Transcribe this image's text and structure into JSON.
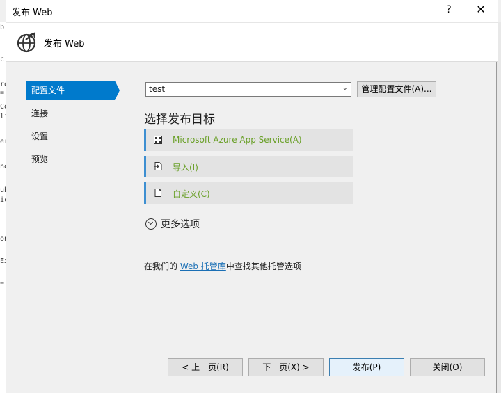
{
  "window": {
    "title": "发布 Web",
    "help_glyph": "?",
    "close_glyph": "✕"
  },
  "header": {
    "title": "发布 Web",
    "icon": "globe-publish-icon"
  },
  "nav": {
    "items": [
      {
        "label": "配置文件",
        "active": true
      },
      {
        "label": "连接",
        "active": false
      },
      {
        "label": "设置",
        "active": false
      },
      {
        "label": "预览",
        "active": false
      }
    ]
  },
  "profile": {
    "selected": "test",
    "manage_label": "管理配置文件(A)..."
  },
  "publish_target": {
    "title": "选择发布目标",
    "options": [
      {
        "label": "Microsoft Azure App Service(A)",
        "icon": "azure-app-service-icon"
      },
      {
        "label": "导入(I)",
        "icon": "import-icon"
      },
      {
        "label": "自定义(C)",
        "icon": "document-icon"
      }
    ],
    "more_label": "更多选项"
  },
  "hosting": {
    "prefix": "在我们的 ",
    "link": "Web 托管库",
    "suffix": "中查找其他托管选项"
  },
  "footer": {
    "prev": "< 上一页(R)",
    "next": "下一页(X) >",
    "publish": "发布(P)",
    "close": "关闭(O)"
  },
  "colors": {
    "accent": "#007acc",
    "target_text": "#6aa028",
    "link": "#1a6fb5"
  }
}
